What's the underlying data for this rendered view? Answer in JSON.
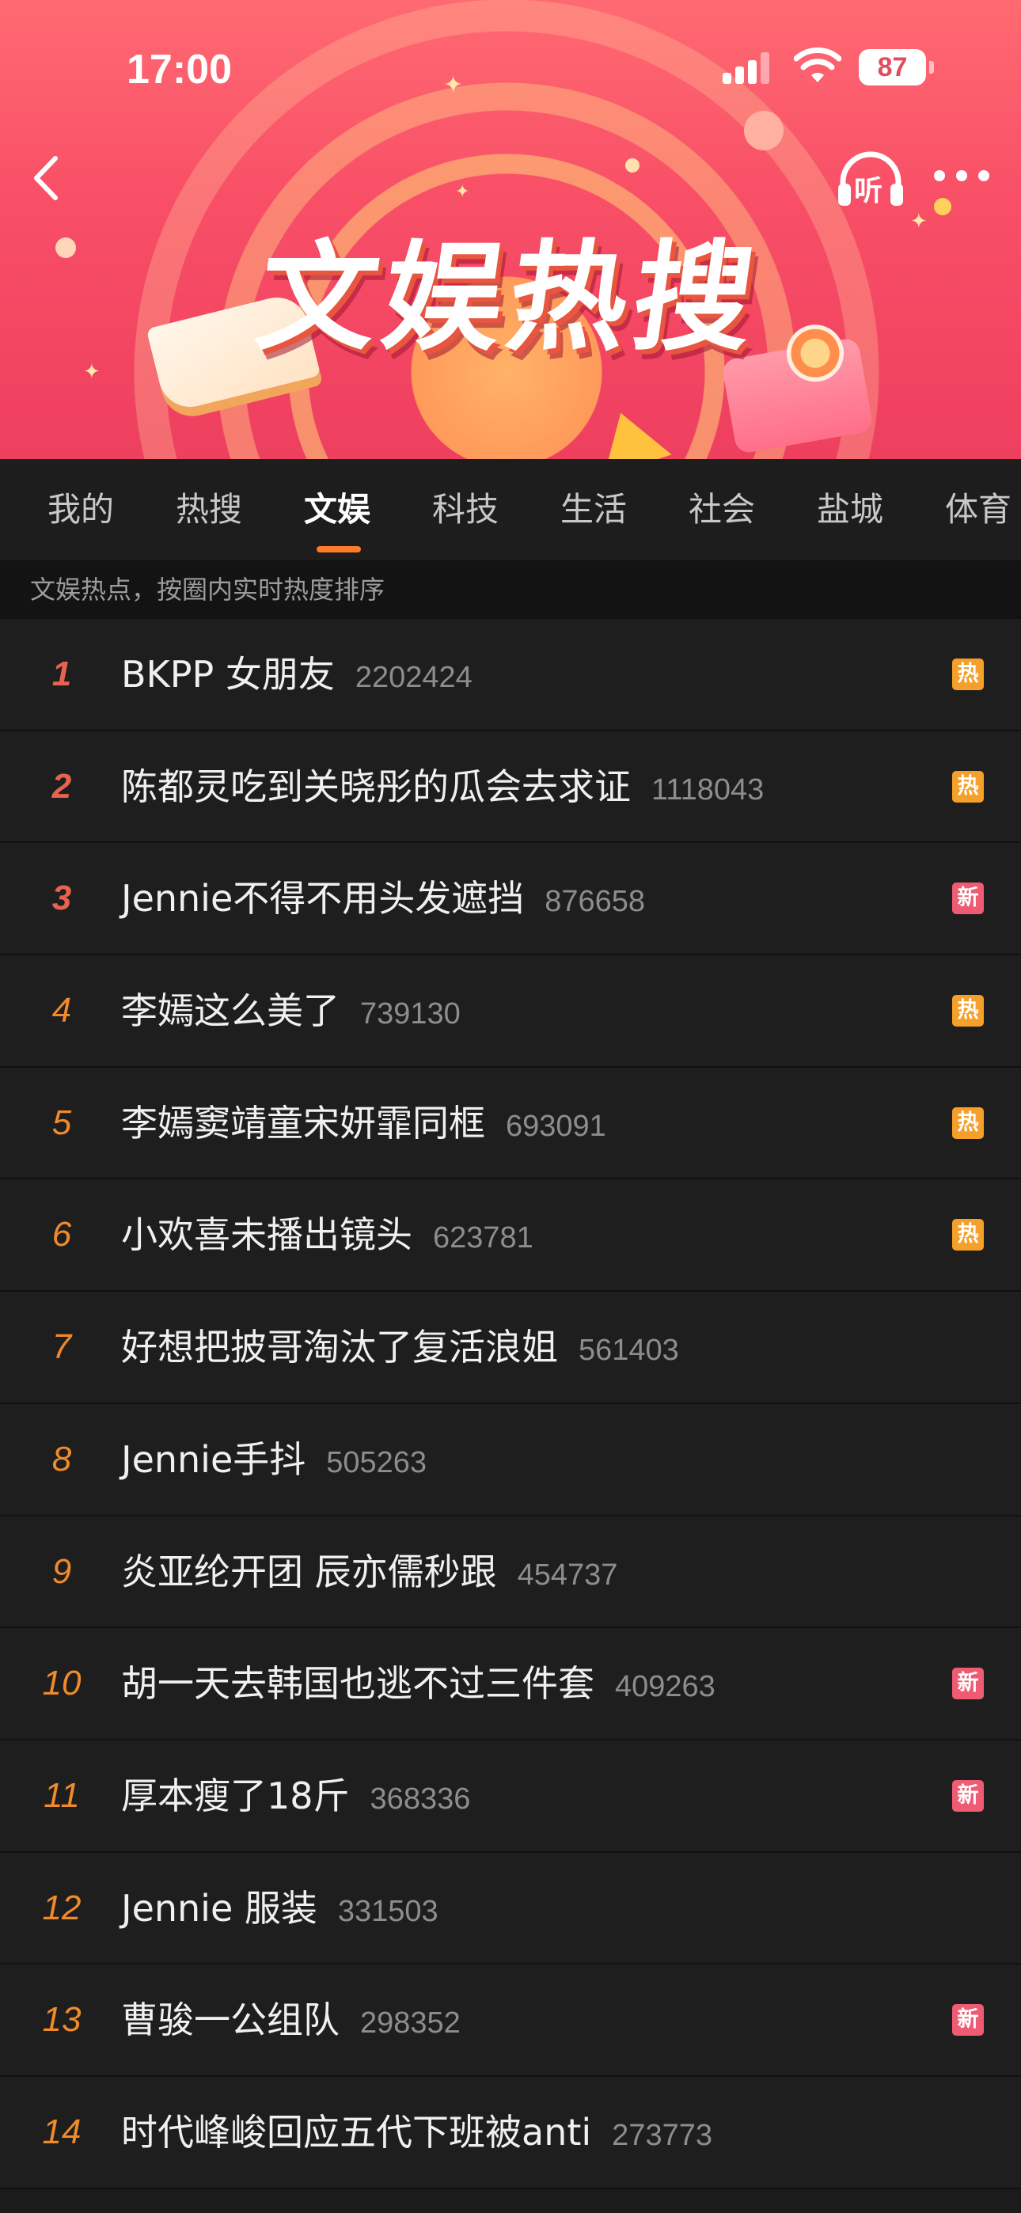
{
  "status_bar": {
    "time": "17:00",
    "battery": "87"
  },
  "banner": {
    "title": "文娱热搜"
  },
  "nav": {
    "listen_label": "听"
  },
  "tabs": [
    {
      "label": "我的",
      "active": false
    },
    {
      "label": "热搜",
      "active": false
    },
    {
      "label": "文娱",
      "active": true
    },
    {
      "label": "科技",
      "active": false
    },
    {
      "label": "生活",
      "active": false
    },
    {
      "label": "社会",
      "active": false
    },
    {
      "label": "盐城",
      "active": false
    },
    {
      "label": "体育",
      "active": false
    }
  ],
  "subheader": "文娱热点，按圈内实时热度排序",
  "badge_colors": {
    "hot": "#f5a02a",
    "new": "#ef5b73"
  },
  "accent_color": "#ff7a2b",
  "list": [
    {
      "rank": "1",
      "title": "BKPP 女朋友",
      "count": "2202424",
      "badge": "热"
    },
    {
      "rank": "2",
      "title": "陈都灵吃到关晓彤的瓜会去求证",
      "count": "1118043",
      "badge": "热"
    },
    {
      "rank": "3",
      "title": "Jennie不得不用头发遮挡",
      "count": "876658",
      "badge": "新"
    },
    {
      "rank": "4",
      "title": "李嫣这么美了",
      "count": "739130",
      "badge": "热"
    },
    {
      "rank": "5",
      "title": "李嫣窦靖童宋妍霏同框",
      "count": "693091",
      "badge": "热"
    },
    {
      "rank": "6",
      "title": "小欢喜未播出镜头",
      "count": "623781",
      "badge": "热"
    },
    {
      "rank": "7",
      "title": "好想把披哥淘汰了复活浪姐",
      "count": "561403",
      "badge": ""
    },
    {
      "rank": "8",
      "title": "Jennie手抖",
      "count": "505263",
      "badge": ""
    },
    {
      "rank": "9",
      "title": "炎亚纶开团 辰亦儒秒跟",
      "count": "454737",
      "badge": ""
    },
    {
      "rank": "10",
      "title": "胡一天去韩国也逃不过三件套",
      "count": "409263",
      "badge": "新"
    },
    {
      "rank": "11",
      "title": "厚本瘦了18斤",
      "count": "368336",
      "badge": "新"
    },
    {
      "rank": "12",
      "title": "Jennie 服装",
      "count": "331503",
      "badge": ""
    },
    {
      "rank": "13",
      "title": "曹骏一公组队",
      "count": "298352",
      "badge": "新"
    },
    {
      "rank": "14",
      "title": "时代峰峻回应五代下班被anti",
      "count": "273773",
      "badge": ""
    }
  ]
}
